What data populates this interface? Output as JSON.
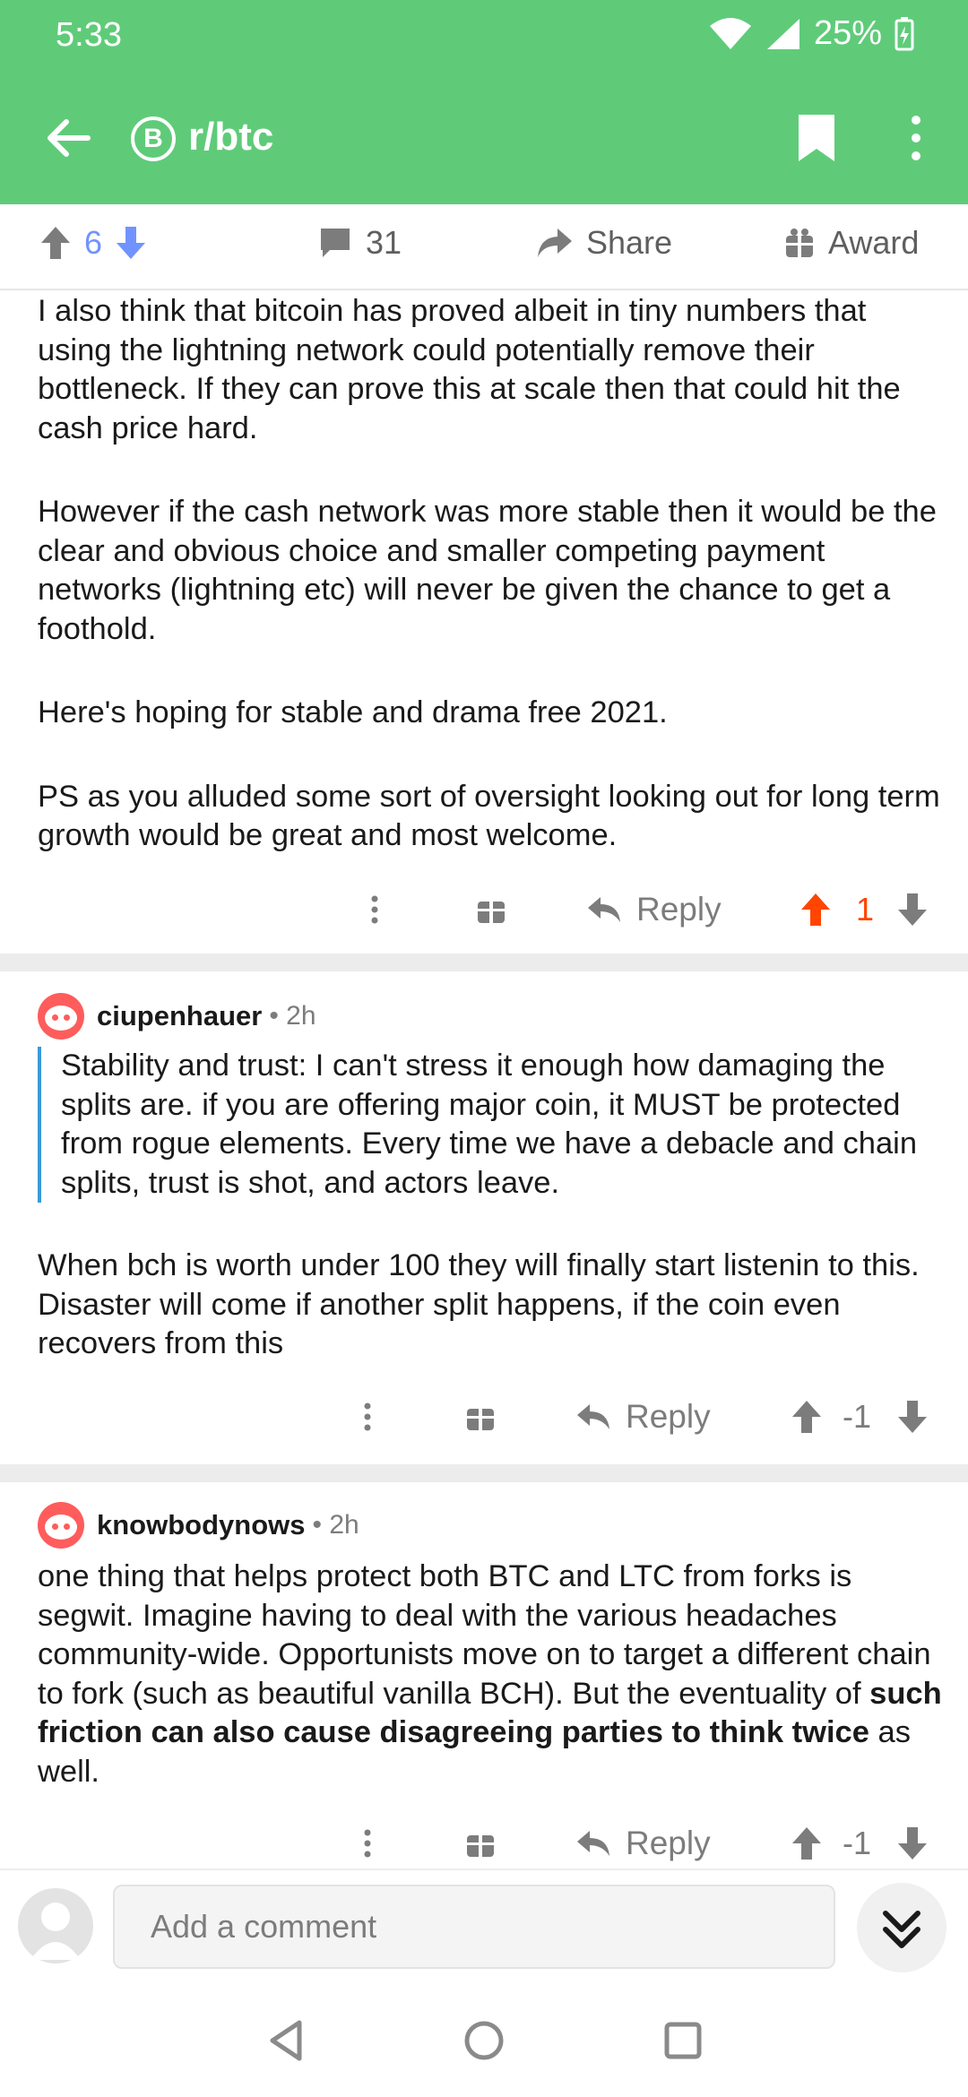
{
  "status_bar": {
    "time": "5:33",
    "battery": "25%"
  },
  "app_bar": {
    "subreddit": "r/btc",
    "sub_icon_glyph": "B"
  },
  "post_actions": {
    "upvotes": "6",
    "comments": "31",
    "share": "Share",
    "award": "Award"
  },
  "post_text": [
    "I also think that bitcoin has proved albeit in tiny numbers that using the lightning network could potentially remove their bottleneck. If they can prove this at scale then that could hit the cash price hard.",
    "However if the cash network was more stable then it would be the clear and obvious choice and smaller competing payment networks (lightning etc) will never be given the chance to get a foothold.",
    "Here's hoping for stable and drama free 2021.",
    "PS as you alluded some sort of oversight looking out for long term growth would be great and most welcome."
  ],
  "comment_actions_1": {
    "reply": "Reply",
    "score": "1"
  },
  "comment_1": {
    "author": "ciupenhauer",
    "meta": "• 2h",
    "quote": "Stability and trust: I can't stress it enough how damaging the splits are. if you are offering major coin, it MUST be protected from rogue elements. Every time we have a debacle and chain splits, trust is shot, and actors leave.",
    "body": "When bch is worth under 100 they will finally start listenin to this. Disaster will come if another split happens, if the coin even recovers from this",
    "reply": "Reply",
    "score": "-1"
  },
  "comment_2": {
    "author": "knowbodynows",
    "meta": "• 2h",
    "body_start": "one thing that helps protect both BTC and LTC from forks is segwit. Imagine having to deal with the various headaches community-wide. Opportunists move on to target a different chain to fork (such as beautiful vanilla BCH). But the eventuality of ",
    "body_bold": "such friction can also cause disagreeing parties to think twice",
    "body_end": " as well.",
    "reply": "Reply",
    "score": "-1"
  },
  "composer": {
    "placeholder": "Add a comment"
  },
  "colors": {
    "appbar": "#5fcb79",
    "upvote_active": "#ff4500",
    "vote_blue": "#7193ff",
    "quote_bar": "#3a9ad9"
  }
}
